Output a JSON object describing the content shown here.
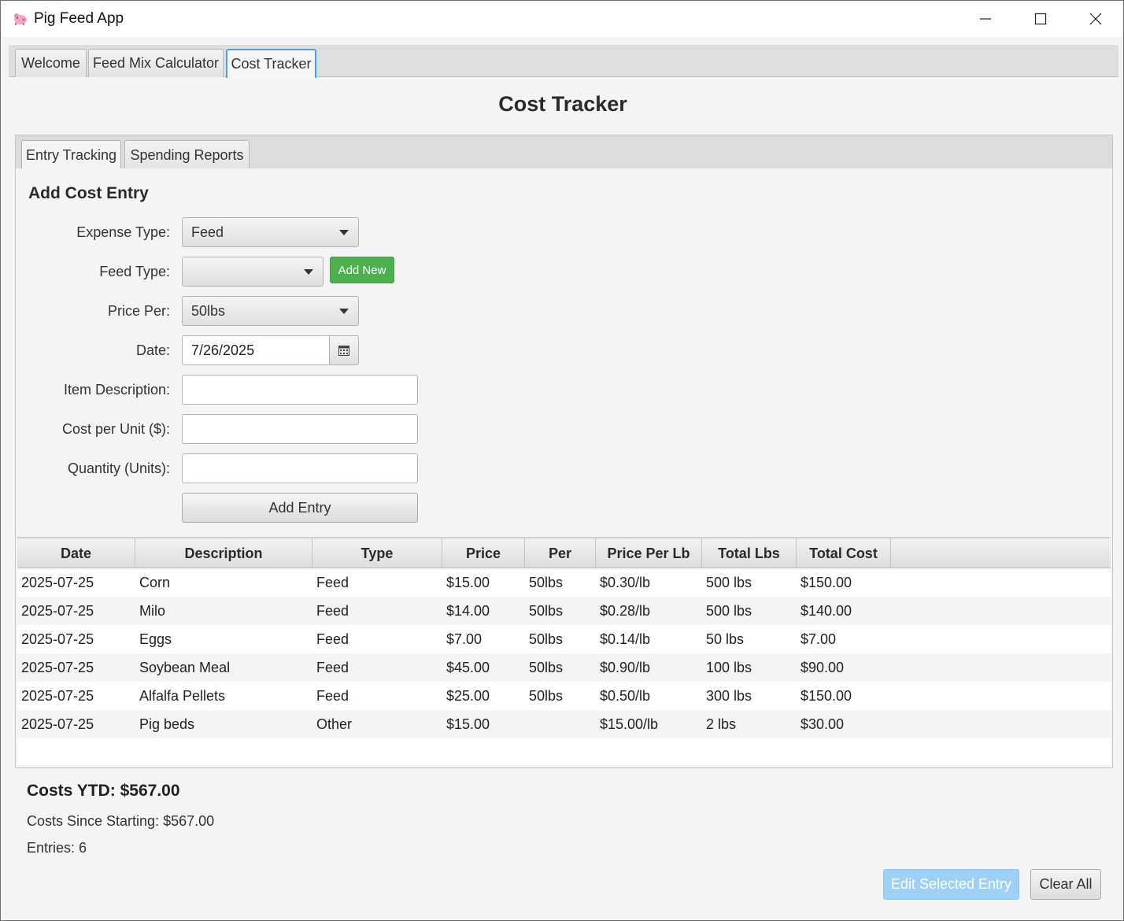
{
  "window": {
    "title": "Pig Feed App"
  },
  "outer_tabs": [
    {
      "label": "Welcome"
    },
    {
      "label": "Feed Mix Calculator"
    },
    {
      "label": "Cost Tracker"
    }
  ],
  "page_title": "Cost Tracker",
  "inner_tabs": [
    {
      "label": "Entry Tracking"
    },
    {
      "label": "Spending Reports"
    }
  ],
  "form": {
    "section_title": "Add Cost Entry",
    "expense_type": {
      "label": "Expense Type:",
      "value": "Feed"
    },
    "feed_type": {
      "label": "Feed Type:",
      "value": "",
      "add_new_label": "Add New"
    },
    "price_per": {
      "label": "Price Per:",
      "value": "50lbs"
    },
    "date": {
      "label": "Date:",
      "value": "7/26/2025"
    },
    "item_description": {
      "label": "Item Description:",
      "value": ""
    },
    "cost_per_unit": {
      "label": "Cost per Unit ($):",
      "value": ""
    },
    "quantity": {
      "label": "Quantity (Units):",
      "value": ""
    },
    "add_entry_label": "Add Entry"
  },
  "table": {
    "columns": [
      "Date",
      "Description",
      "Type",
      "Price",
      "Per",
      "Price Per Lb",
      "Total Lbs",
      "Total Cost"
    ],
    "rows": [
      [
        "2025-07-25",
        "Corn",
        "Feed",
        "$15.00",
        "50lbs",
        "$0.30/lb",
        "500 lbs",
        "$150.00"
      ],
      [
        "2025-07-25",
        "Milo",
        "Feed",
        "$14.00",
        "50lbs",
        "$0.28/lb",
        "500 lbs",
        "$140.00"
      ],
      [
        "2025-07-25",
        "Eggs",
        "Feed",
        "$7.00",
        "50lbs",
        "$0.14/lb",
        "50 lbs",
        "$7.00"
      ],
      [
        "2025-07-25",
        "Soybean Meal",
        "Feed",
        "$45.00",
        "50lbs",
        "$0.90/lb",
        "100 lbs",
        "$90.00"
      ],
      [
        "2025-07-25",
        "Alfalfa Pellets",
        "Feed",
        "$25.00",
        "50lbs",
        "$0.50/lb",
        "300 lbs",
        "$150.00"
      ],
      [
        "2025-07-25",
        "Pig beds",
        "Other",
        "$15.00",
        "",
        "$15.00/lb",
        "2 lbs",
        "$30.00"
      ]
    ]
  },
  "summary": {
    "ytd": "Costs YTD: $567.00",
    "since_starting": "Costs Since Starting: $567.00",
    "entries": "Entries: 6"
  },
  "actions": {
    "edit_label": "Edit Selected Entry",
    "clear_label": "Clear All"
  },
  "colors": {
    "accent_green": "#4caf50",
    "selected_tab_border": "#4aa3df",
    "disabled_blue": "#9fd0f5"
  }
}
